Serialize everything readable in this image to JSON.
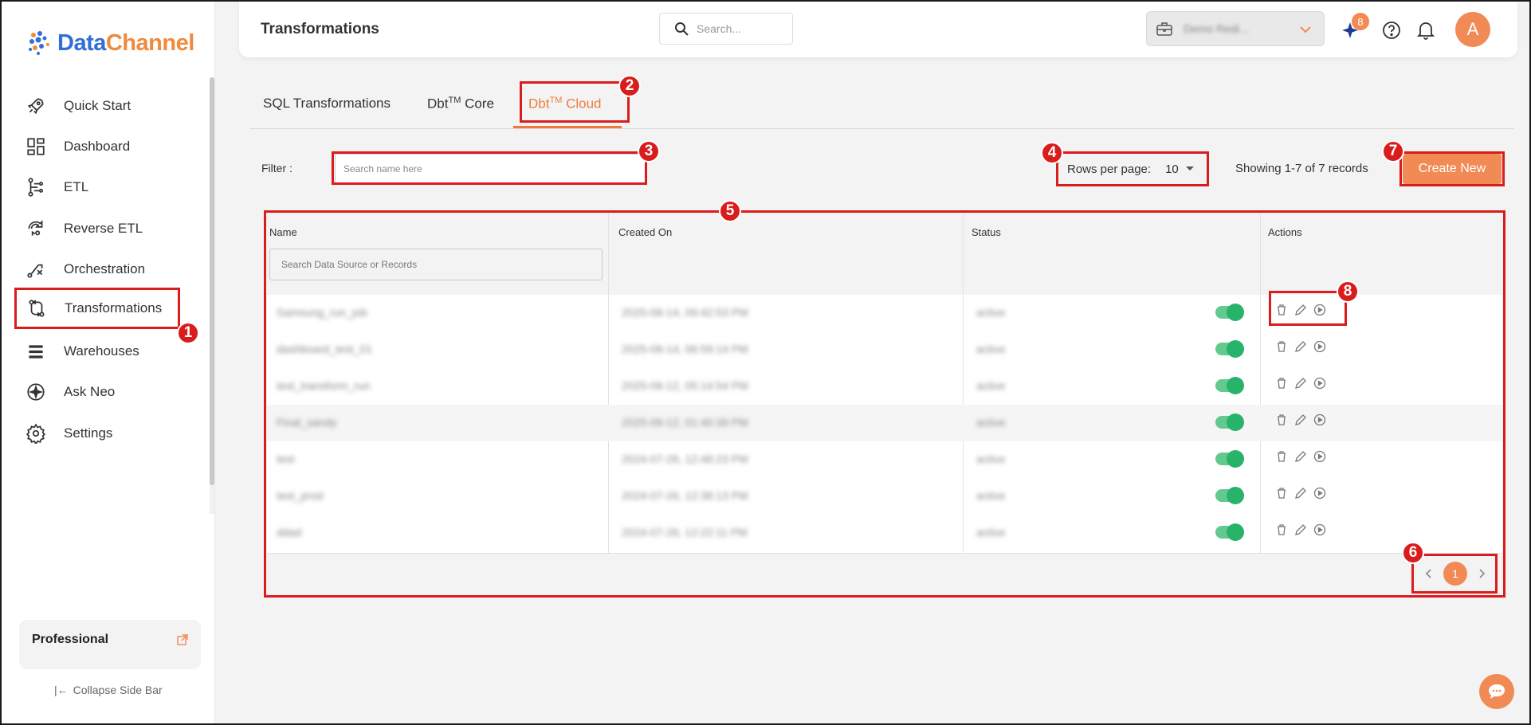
{
  "brand": {
    "name_part1": "Data",
    "name_part2": "Channel"
  },
  "sidebar": {
    "items": [
      {
        "label": "Quick Start",
        "icon": "rocket-icon"
      },
      {
        "label": "Dashboard",
        "icon": "dashboard-icon"
      },
      {
        "label": "ETL",
        "icon": "etl-icon"
      },
      {
        "label": "Reverse ETL",
        "icon": "reverse-etl-icon"
      },
      {
        "label": "Orchestration",
        "icon": "orchestration-icon"
      },
      {
        "label": "Transformations",
        "icon": "transformations-icon"
      },
      {
        "label": "Warehouses",
        "icon": "warehouses-icon"
      },
      {
        "label": "Ask Neo",
        "icon": "ask-neo-icon"
      },
      {
        "label": "Settings",
        "icon": "gear-icon"
      }
    ],
    "active": "Transformations",
    "plan": "Professional",
    "collapse": "Collapse Side Bar"
  },
  "header": {
    "title": "Transformations",
    "search_placeholder": "Search...",
    "workspace": "Demo Redi...",
    "notification_count": "8",
    "avatar": "A"
  },
  "tabs": [
    {
      "label": "SQL Transformations",
      "sup": ""
    },
    {
      "label": "Dbt",
      "sup": "TM",
      "suffix": " Core"
    },
    {
      "label": "Dbt",
      "sup": "TM",
      "suffix": " Cloud"
    }
  ],
  "filter": {
    "label": "Filter :",
    "placeholder": "Search name here",
    "rows_per_page_label": "Rows per page:",
    "rows_per_page_value": "10",
    "records_text": "Showing 1-7 of 7 records",
    "create_button": "Create New"
  },
  "table": {
    "columns": [
      "Name",
      "Created On",
      "Status",
      "Actions"
    ],
    "name_search_placeholder": "Search Data Source or Records",
    "rows": [
      {
        "name": "Samsung_run_job",
        "created": "2025-08-14, 09:42:53 PM",
        "status": "active"
      },
      {
        "name": "dashboard_test_01",
        "created": "2025-08-14, 06:59:14 PM",
        "status": "active"
      },
      {
        "name": "test_transform_run",
        "created": "2025-08-12, 05:14:54 PM",
        "status": "active"
      },
      {
        "name": "Final_sandy",
        "created": "2025-08-12, 01:40:39 PM",
        "status": "active"
      },
      {
        "name": "test",
        "created": "2024-07-26, 12:48:23 PM",
        "status": "active"
      },
      {
        "name": "test_prod",
        "created": "2024-07-26, 12:38:13 PM",
        "status": "active"
      },
      {
        "name": "ddad",
        "created": "2024-07-26, 12:22:11 PM",
        "status": "active"
      }
    ],
    "current_page": "1"
  },
  "colors": {
    "accent": "#f28a55",
    "annotation": "#d91c1c",
    "toggle_on": "#27b36a"
  }
}
